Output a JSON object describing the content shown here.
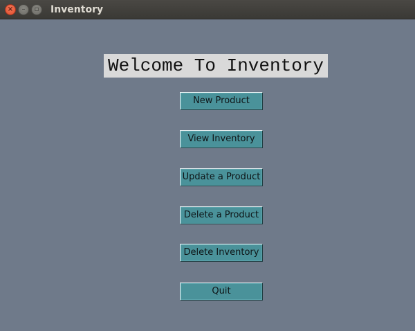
{
  "window": {
    "title": "Inventory",
    "controls": {
      "close_glyph": "×",
      "minimize_glyph": "–",
      "maximize_glyph": "▫"
    }
  },
  "main": {
    "heading": "Welcome To Inventory",
    "buttons": [
      {
        "label": "New Product"
      },
      {
        "label": "View Inventory"
      },
      {
        "label": "Update a Product"
      },
      {
        "label": "Delete a Product"
      },
      {
        "label": "Delete Inventory"
      },
      {
        "label": "Quit"
      }
    ]
  },
  "colors": {
    "background": "#6f7a8a",
    "heading_bg": "#d9d9d9",
    "button_bg": "#4a929a",
    "titlebar": "#3f3e3a"
  }
}
